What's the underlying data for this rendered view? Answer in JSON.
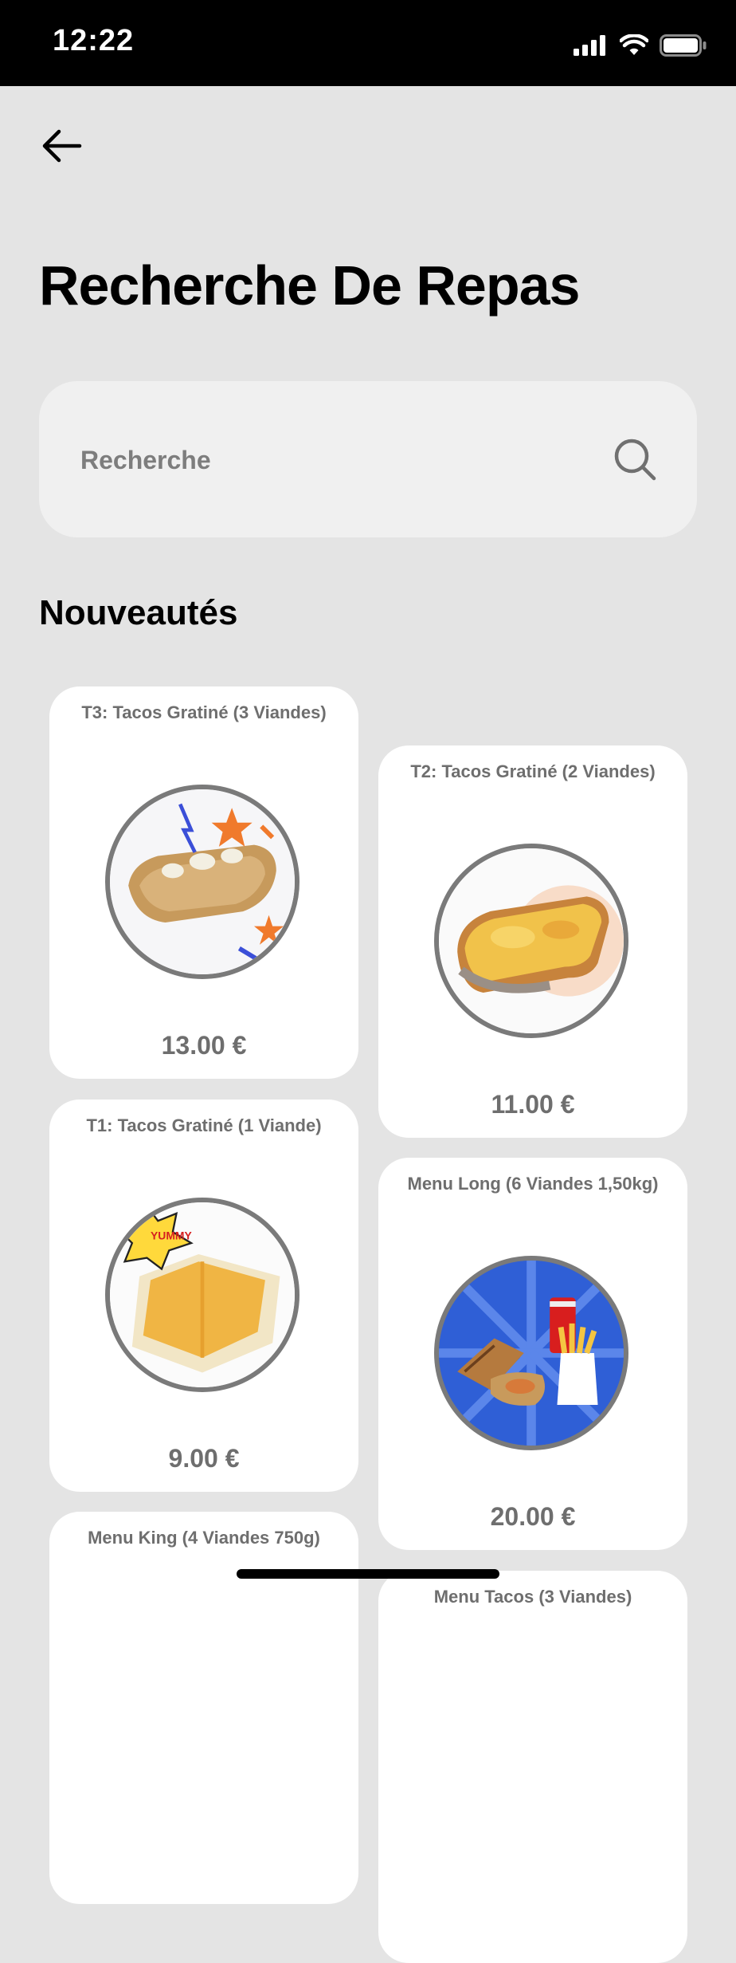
{
  "status_bar": {
    "time": "12:22"
  },
  "header": {
    "title": "Recherche De Repas"
  },
  "search": {
    "placeholder": "Recherche"
  },
  "section": {
    "title": "Nouveautés"
  },
  "products": [
    {
      "name": "T3: Tacos Gratiné (3 Viandes)",
      "price": "13.00 €"
    },
    {
      "name": "T2: Tacos Gratiné (2 Viandes)",
      "price": "11.00 €"
    },
    {
      "name": "T1: Tacos Gratiné (1 Viande)",
      "price": "9.00 €"
    },
    {
      "name": "Menu Long (6 Viandes 1,50kg)",
      "price": "20.00 €"
    },
    {
      "name": "Menu King (4 Viandes 750g)",
      "price": ""
    },
    {
      "name": "Menu Tacos (3 Viandes)",
      "price": ""
    }
  ]
}
